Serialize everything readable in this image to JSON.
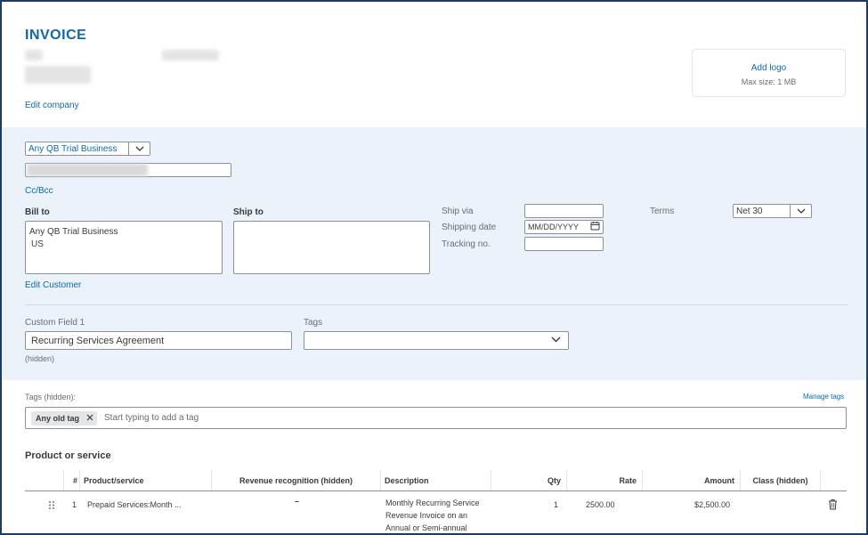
{
  "header": {
    "title": "INVOICE",
    "edit_company": "Edit company",
    "logo": {
      "add": "Add logo",
      "max_size": "Max size: 1 MB"
    }
  },
  "customer": {
    "selected": "Any QB Trial Business",
    "cc_bcc": "Cc/Bcc",
    "bill_to_label": "Bill to",
    "bill_to_lines": [
      "Any QB Trial Business",
      "US"
    ],
    "ship_to_label": "Ship to",
    "edit_customer": "Edit Customer"
  },
  "shipping": {
    "ship_via_label": "Ship via",
    "shipping_date_label": "Shipping date",
    "shipping_date_placeholder": "MM/DD/YYYY",
    "tracking_label": "Tracking no.",
    "terms_label": "Terms",
    "terms_value": "Net 30"
  },
  "custom": {
    "field_label": "Custom Field 1",
    "field_value": "Recurring Services Agreement",
    "field_note": "(hidden)",
    "tags_label": "Tags"
  },
  "tags": {
    "label": "Tags (hidden):",
    "manage": "Manage tags",
    "chip": "Any old tag",
    "placeholder": "Start typing to add a tag"
  },
  "products": {
    "title": "Product or service",
    "columns": {
      "num": "#",
      "product": "Product/service",
      "revenue": "Revenue recognition (hidden)",
      "description": "Description",
      "qty": "Qty",
      "rate": "Rate",
      "amount": "Amount",
      "class": "Class (hidden)"
    },
    "rows": [
      {
        "num": "1",
        "product": "Prepaid Services:Month ...",
        "revenue": "–",
        "description": [
          "Monthly Recurring Service",
          "Revenue Invoice on an",
          "Annual or Semi-annual"
        ],
        "qty": "1",
        "rate": "2500.00",
        "amount": "$2,500.00"
      }
    ]
  },
  "colors": {
    "brand_blue": "#0d6aa8",
    "panel_bg": "#ebf2fa",
    "frame": "#1f3b63"
  }
}
